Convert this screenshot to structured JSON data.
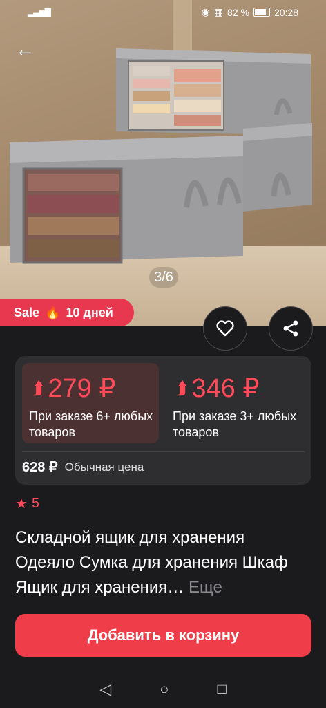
{
  "status": {
    "time": "20:28",
    "battery": "82 %",
    "signal": "▂▃▅▇"
  },
  "gallery": {
    "counter": "3/6"
  },
  "sale": {
    "label": "Sale",
    "suffix": "10 дней",
    "icon": "fire-icon"
  },
  "prices": [
    {
      "value": "279 ₽",
      "condition": "При заказе 6+ любых товаров"
    },
    {
      "value": "346 ₽",
      "condition": "При заказе 3+ любых товаров"
    }
  ],
  "regular": {
    "price": "628 ₽",
    "label": "Обычная цена"
  },
  "rating": {
    "value": "5"
  },
  "product": {
    "title": "Складной ящик для хранения Одеяло Сумка для хранения Шкаф Ящик для хранения…",
    "more": "Еще"
  },
  "cart": {
    "label": "Добавить в корзину"
  },
  "colors": {
    "accent": "#ef3e4a",
    "price_red": "#ff4a5a",
    "card_bg": "#2e2e31",
    "active_price_bg": "#4b3131"
  }
}
